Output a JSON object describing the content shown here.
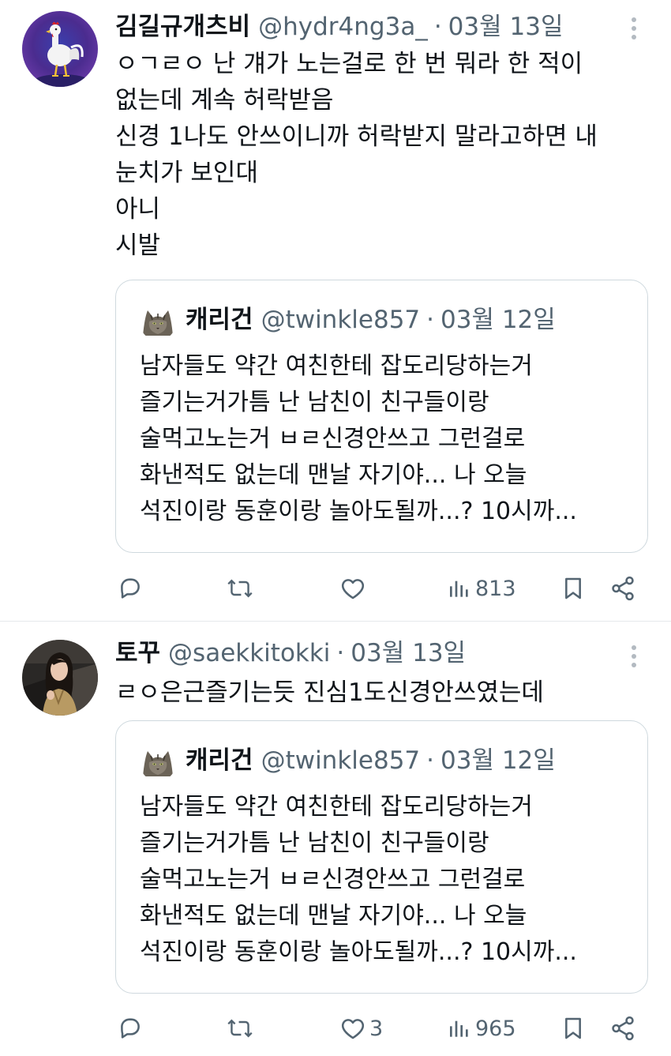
{
  "tweets": [
    {
      "author_name": "김길규개츠비",
      "handle": "@hydr4ng3a_",
      "separator": "·",
      "date": "03월 13일",
      "avatar_icon": "rooster-avatar",
      "body": "ㅇㄱㄹㅇ 난 걔가 노는걸로 한 번 뭐라 한 적이\n없는데 계속 허락받음\n신경 1나도 안쓰이니까 허락받지 말라고하면 내\n눈치가 보인대\n아니\n시발",
      "quote": {
        "author_name": "캐리건",
        "handle": "@twinkle857",
        "separator": "·",
        "date": "03월 12일",
        "avatar_icon": "cat-avatar",
        "body": "남자들도 약간 여친한테 잡도리당하는거\n즐기는거가틈 난 남친이 친구들이랑\n술먹고노는거 ㅂㄹ신경안쓰고 그런걸로\n화낸적도 없는데 맨날 자기야... 나 오늘\n석진이랑 동훈이랑 놀아도될까...? 10시까..."
      },
      "actions": {
        "reply_count": "",
        "retweet_count": "",
        "like_count": "",
        "views_count": "813"
      }
    },
    {
      "author_name": "토꾸",
      "handle": "@saekkitokki",
      "separator": "·",
      "date": "03월 13일",
      "avatar_icon": "woman-photo-avatar",
      "body": "ㄹㅇ은근즐기는듯 진심1도신경안쓰였는데",
      "quote": {
        "author_name": "캐리건",
        "handle": "@twinkle857",
        "separator": "·",
        "date": "03월 12일",
        "avatar_icon": "cat-avatar",
        "body": "남자들도 약간 여친한테 잡도리당하는거\n즐기는거가틈 난 남친이 친구들이랑\n술먹고노는거 ㅂㄹ신경안쓰고 그런걸로\n화낸적도 없는데 맨날 자기야... 나 오늘\n석진이랑 동훈이랑 놀아도될까...? 10시까..."
      },
      "actions": {
        "reply_count": "",
        "retweet_count": "",
        "like_count": "3",
        "views_count": "965"
      }
    }
  ],
  "colors": {
    "text_primary": "#0f1419",
    "text_secondary": "#536471",
    "border": "#cfd9de",
    "divider": "#e6e9ec",
    "background": "#ffffff"
  }
}
